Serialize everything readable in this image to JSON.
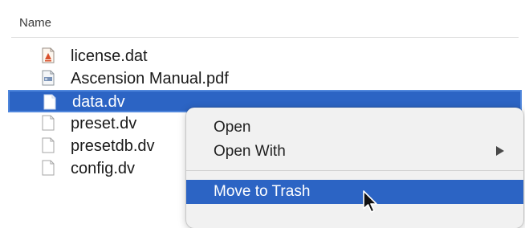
{
  "header": {
    "column_name": "Name"
  },
  "files": [
    {
      "name": "license.dat",
      "icon": "dat-file-icon",
      "selected": false
    },
    {
      "name": "Ascension Manual.pdf",
      "icon": "pdf-file-icon",
      "selected": false
    },
    {
      "name": "data.dv",
      "icon": "blank-file-icon",
      "selected": true
    },
    {
      "name": "preset.dv",
      "icon": "blank-file-icon",
      "selected": false
    },
    {
      "name": "presetdb.dv",
      "icon": "blank-file-icon",
      "selected": false
    },
    {
      "name": "config.dv",
      "icon": "blank-file-icon",
      "selected": false
    }
  ],
  "context_menu": {
    "items": [
      {
        "label": "Open"
      },
      {
        "label": "Open With",
        "has_submenu": true
      },
      {
        "label": "Move to Trash",
        "highlighted": true
      }
    ]
  },
  "colors": {
    "selection": "#2c64c4",
    "menu_bg": "#f1f1f1"
  }
}
